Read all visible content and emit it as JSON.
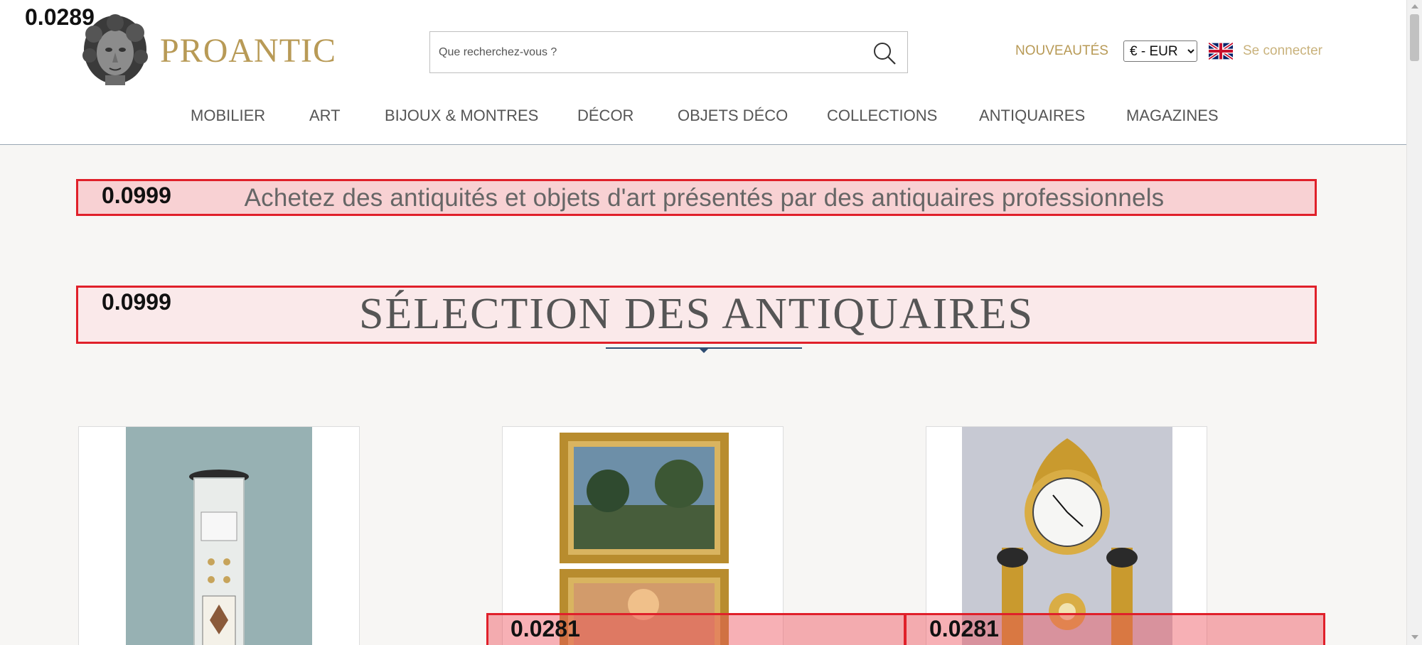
{
  "overlay_scores": {
    "top_left": "0.0289",
    "tagline": "0.0999",
    "section": "0.0999",
    "card2_band": "0.0281",
    "card3_band": "0.0281"
  },
  "header": {
    "brand": "PROANTIC",
    "search_placeholder": "Que recherchez-vous ?",
    "nouveautes": "NOUVEAUTÉS",
    "currency_selected": "€ - EUR",
    "login": "Se connecter"
  },
  "nav": {
    "items": [
      "MOBILIER",
      "ART",
      "BIJOUX & MONTRES",
      "DÉCOR",
      "OBJETS DÉCO",
      "COLLECTIONS",
      "ANTIQUAIRES",
      "MAGAZINES"
    ]
  },
  "main": {
    "tagline": "Achetez des antiquités et objets d'art présentés par des antiquaires professionnels",
    "section_title": "SÉLECTION DES ANTIQUAIRES"
  },
  "icons": {
    "logo": "bust-logo-icon",
    "search": "search-icon",
    "flag": "uk-flag-icon"
  },
  "colors": {
    "brand_gold": "#b89a56",
    "highlight_red": "#e0202a",
    "divider_blue": "#2e4d72"
  }
}
